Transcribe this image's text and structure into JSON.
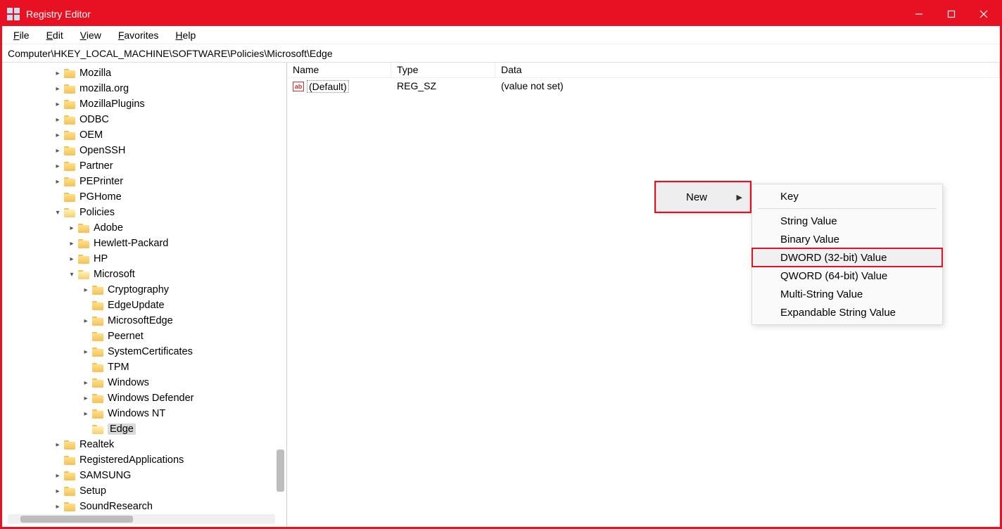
{
  "title": "Registry Editor",
  "menus": {
    "file": "File",
    "edit": "Edit",
    "view": "View",
    "favorites": "Favorites",
    "help": "Help"
  },
  "address": "Computer\\HKEY_LOCAL_MACHINE\\SOFTWARE\\Policies\\Microsoft\\Edge",
  "columns": {
    "name": "Name",
    "type": "Type",
    "data": "Data"
  },
  "rows": [
    {
      "name": "(Default)",
      "type": "REG_SZ",
      "data": "(value not set)"
    }
  ],
  "tree": {
    "mozilla": "Mozilla",
    "mozillaorg": "mozilla.org",
    "mozillaplugins": "MozillaPlugins",
    "odbc": "ODBC",
    "oem": "OEM",
    "openssh": "OpenSSH",
    "partner": "Partner",
    "peprinter": "PEPrinter",
    "pghome": "PGHome",
    "policies": "Policies",
    "adobe": "Adobe",
    "hp_pack": "Hewlett-Packard",
    "hp": "HP",
    "microsoft": "Microsoft",
    "cryptography": "Cryptography",
    "edgeupdate": "EdgeUpdate",
    "microsoftedge": "MicrosoftEdge",
    "peernet": "Peernet",
    "systemcertificates": "SystemCertificates",
    "tpm": "TPM",
    "windows": "Windows",
    "windowsdefender": "Windows Defender",
    "windowsnt": "Windows NT",
    "edge": "Edge",
    "realtek": "Realtek",
    "registeredapps": "RegisteredApplications",
    "samsung": "SAMSUNG",
    "setup": "Setup",
    "soundresearch": "SoundResearch"
  },
  "context": {
    "new": "New",
    "sub": {
      "key": "Key",
      "string": "String Value",
      "binary": "Binary Value",
      "dword": "DWORD (32-bit) Value",
      "qword": "QWORD (64-bit) Value",
      "multi": "Multi-String Value",
      "expand": "Expandable String Value"
    }
  }
}
